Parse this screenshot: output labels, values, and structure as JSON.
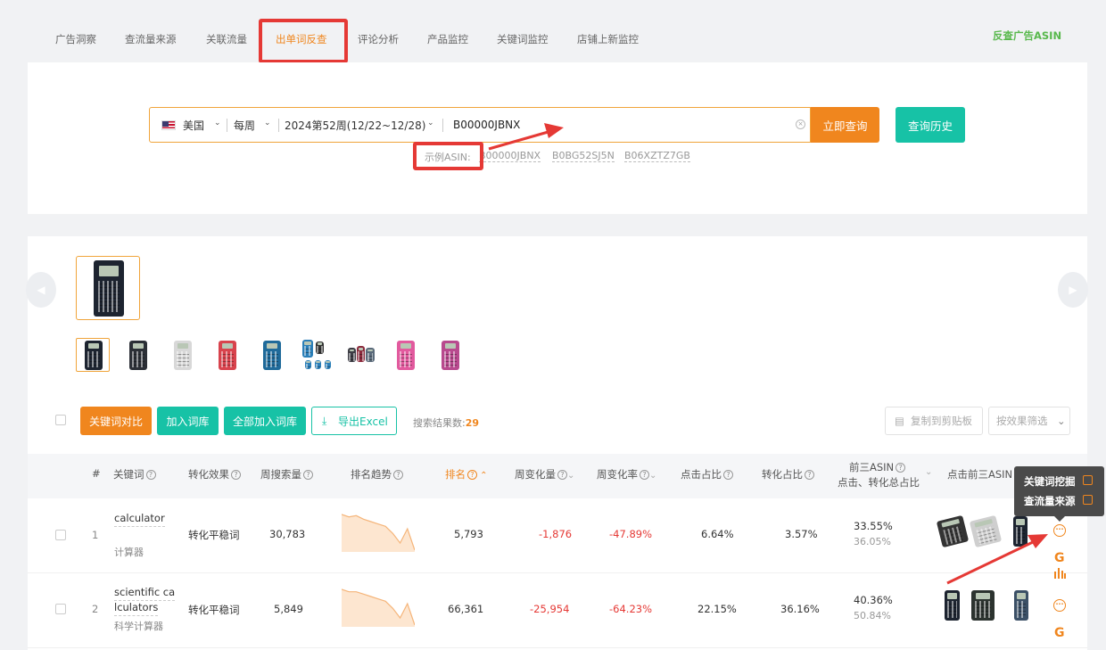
{
  "nav": {
    "tabs": [
      "广告洞察",
      "查流量来源",
      "关联流量",
      "出单词反查",
      "评论分析",
      "产品监控",
      "关键词监控",
      "店铺上新监控"
    ],
    "active_index": 3,
    "right_link": "反查广告ASIN"
  },
  "search": {
    "country": "美国",
    "period": "每周",
    "week": "2024第52周(12/22~12/28)",
    "asin_value": "B00000JBNX",
    "query_label": "立即查询",
    "history_label": "查询历史",
    "example_label": "示例ASIN:",
    "examples": [
      "B00000JBNX",
      "B0BG52SJ5N",
      "B06XZTZ7GB"
    ]
  },
  "toolbar": {
    "compare": "关键词对比",
    "add_lib": "加入词库",
    "add_all_lib": "全部加入词库",
    "export": "导出Excel",
    "count_label": "搜索结果数:",
    "count": "29",
    "copy": "复制到剪贴板",
    "filter": "按效果筛选"
  },
  "table": {
    "headers": {
      "index": "#",
      "keyword": "关键词",
      "effect": "转化效果",
      "volume": "周搜索量",
      "trend": "排名趋势",
      "rank": "排名",
      "change": "周变化量",
      "change_rate": "周变化率",
      "click_share": "点击占比",
      "conv_share": "转化占比",
      "top3_line1": "前三ASIN",
      "top3_line2": "点击、转化总占比",
      "top3_click": "点击前三ASIN"
    },
    "rows": [
      {
        "index": "1",
        "keyword_en": "calculator",
        "keyword_cn": "计算器",
        "effect": "转化平稳词",
        "volume": "30,783",
        "rank": "5,793",
        "change": "-1,876",
        "change_rate": "-47.89%",
        "click_share": "6.64%",
        "conv_share": "3.57%",
        "top3_click": "33.55%",
        "top3_conv": "36.05%",
        "trend": [
          10,
          12,
          11,
          14,
          16,
          18,
          20,
          26,
          34,
          22,
          40
        ]
      },
      {
        "index": "2",
        "keyword_en_1": "scientific ca",
        "keyword_en_2": "lculators",
        "keyword_cn": "科学计算器",
        "effect": "转化平稳词",
        "volume": "5,849",
        "rank": "66,361",
        "change": "-25,954",
        "change_rate": "-64.23%",
        "click_share": "22.15%",
        "conv_share": "36.16%",
        "top3_click": "40.36%",
        "top3_conv": "50.84%",
        "trend": [
          8,
          10,
          10,
          12,
          14,
          16,
          18,
          24,
          32,
          20,
          38
        ]
      }
    ]
  },
  "tooltip": {
    "item1": "关键词挖掘",
    "item2": "查流量来源"
  },
  "colors": {
    "accent": "#f0861e",
    "teal": "#17c2a6",
    "negative": "#e53935",
    "highlight": "#e53935"
  }
}
